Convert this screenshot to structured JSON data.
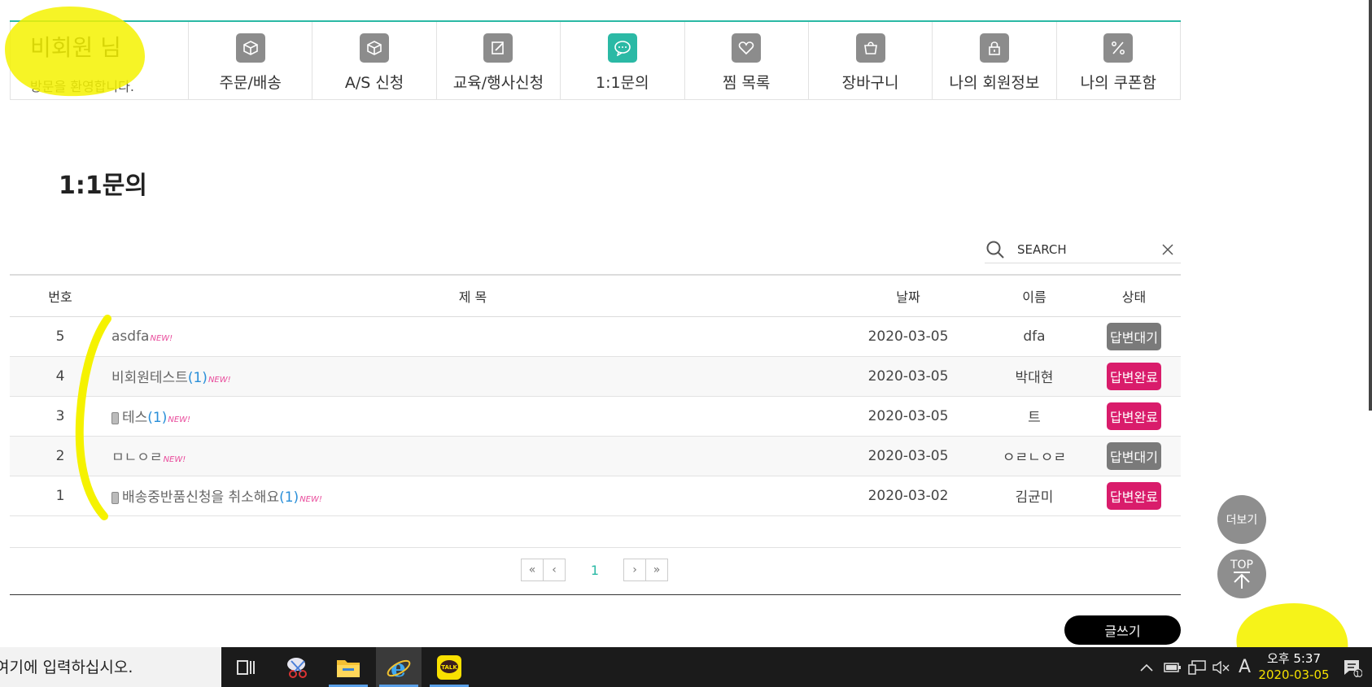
{
  "member": {
    "user": "비회원 님",
    "welcome": "방문을 환영합니다."
  },
  "nav": [
    {
      "label": "주문/배송",
      "icon": "box-icon"
    },
    {
      "label": "A/S 신청",
      "icon": "box-icon"
    },
    {
      "label": "교육/행사신청",
      "icon": "edit-icon"
    },
    {
      "label": "1:1문의",
      "icon": "chat-icon",
      "active": true
    },
    {
      "label": "찜 목록",
      "icon": "heart-icon"
    },
    {
      "label": "장바구니",
      "icon": "bag-icon"
    },
    {
      "label": "나의 회원정보",
      "icon": "lock-icon"
    },
    {
      "label": "나의 쿠폰함",
      "icon": "percent-icon"
    }
  ],
  "page_title": "1:1문의",
  "search": {
    "placeholder": "SEARCH"
  },
  "table": {
    "headers": {
      "no": "번호",
      "title": "제 목",
      "date": "날짜",
      "name": "이름",
      "status": "상태"
    },
    "rows": [
      {
        "no": "5",
        "title": "asdfa",
        "comments": "",
        "new": "NEW!",
        "date": "2020-03-05",
        "name": "dfa",
        "status": "답변대기",
        "status_type": "wait",
        "mobile": false
      },
      {
        "no": "4",
        "title": "비회원테스트",
        "comments": "(1)",
        "new": "NEW!",
        "date": "2020-03-05",
        "name": "박대현",
        "status": "답변완료",
        "status_type": "done",
        "mobile": false
      },
      {
        "no": "3",
        "title": "테스",
        "comments": "(1)",
        "new": "NEW!",
        "date": "2020-03-05",
        "name": "트",
        "status": "답변완료",
        "status_type": "done",
        "mobile": true
      },
      {
        "no": "2",
        "title": "ㅁㄴㅇㄹ",
        "comments": "",
        "new": "NEW!",
        "date": "2020-03-05",
        "name": "ㅇㄹㄴㅇㄹ",
        "status": "답변대기",
        "status_type": "wait",
        "mobile": false
      },
      {
        "no": "1",
        "title": "배송중반품신청을 취소해요",
        "comments": "(1)",
        "new": "NEW!",
        "date": "2020-03-02",
        "name": "김균미",
        "status": "답변완료",
        "status_type": "done",
        "mobile": true
      }
    ]
  },
  "pagination": {
    "first": "«",
    "prev": "‹",
    "current": "1",
    "next": "›",
    "last": "»"
  },
  "write_label": "글쓰기",
  "floating": {
    "more": "더보기",
    "top": "TOP"
  },
  "colors": {
    "accent": "#2bb9a5",
    "done": "#d91c6b",
    "wait": "#7a7a7a"
  },
  "taskbar": {
    "search_text": "여기에 입력하십시오.",
    "ime": "A",
    "clock_time": "오후 5:37",
    "clock_date": "2020-03-05",
    "notifications": "1"
  }
}
